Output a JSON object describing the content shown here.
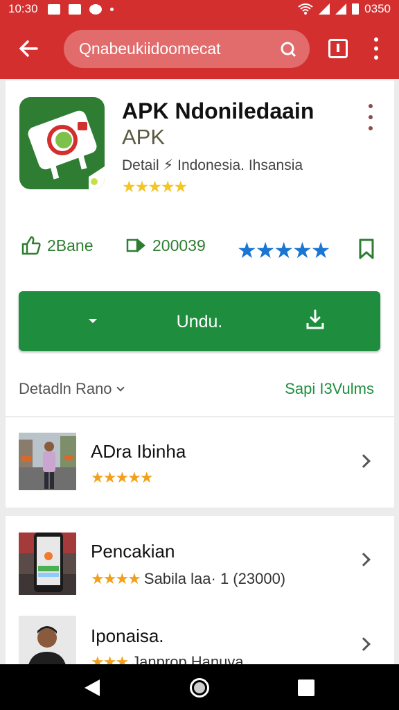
{
  "status_bar": {
    "time": "10:30",
    "right_text": "0350"
  },
  "app_bar": {
    "url": "Qnabeukiidoomecat",
    "back_icon": "arrow-left-icon",
    "search_icon": "search-icon"
  },
  "app": {
    "title": "APK Ndoniledaain",
    "subtitle": "APK",
    "developer": "Detail ⚡ Indonesia. Ihsansia",
    "stars_small": "★★★★★",
    "stat_installs": "2Bane",
    "stat_downloads": "200039",
    "rating_stars": "★★★★★",
    "rating_value": 4.5
  },
  "install": {
    "label": "Undu.",
    "download_icon": "download-icon"
  },
  "details": {
    "label": "Detadln Rano",
    "see_all": "Sapi I3Vulms"
  },
  "list": [
    {
      "title": "ADra Ibinha",
      "stars": "★★★★★",
      "sub": ""
    },
    {
      "title": "Pencakian",
      "stars": "★★★★",
      "sub": "Sabila laa· 1 (23000)"
    },
    {
      "title": "Iponaisa.",
      "stars": "★★★",
      "sub": "Janprop Hanuva"
    }
  ],
  "colors": {
    "accent": "#d32f2f",
    "green": "#1e8e3e",
    "blue_stars": "#1976d2",
    "yellow_stars": "#f3c623"
  }
}
